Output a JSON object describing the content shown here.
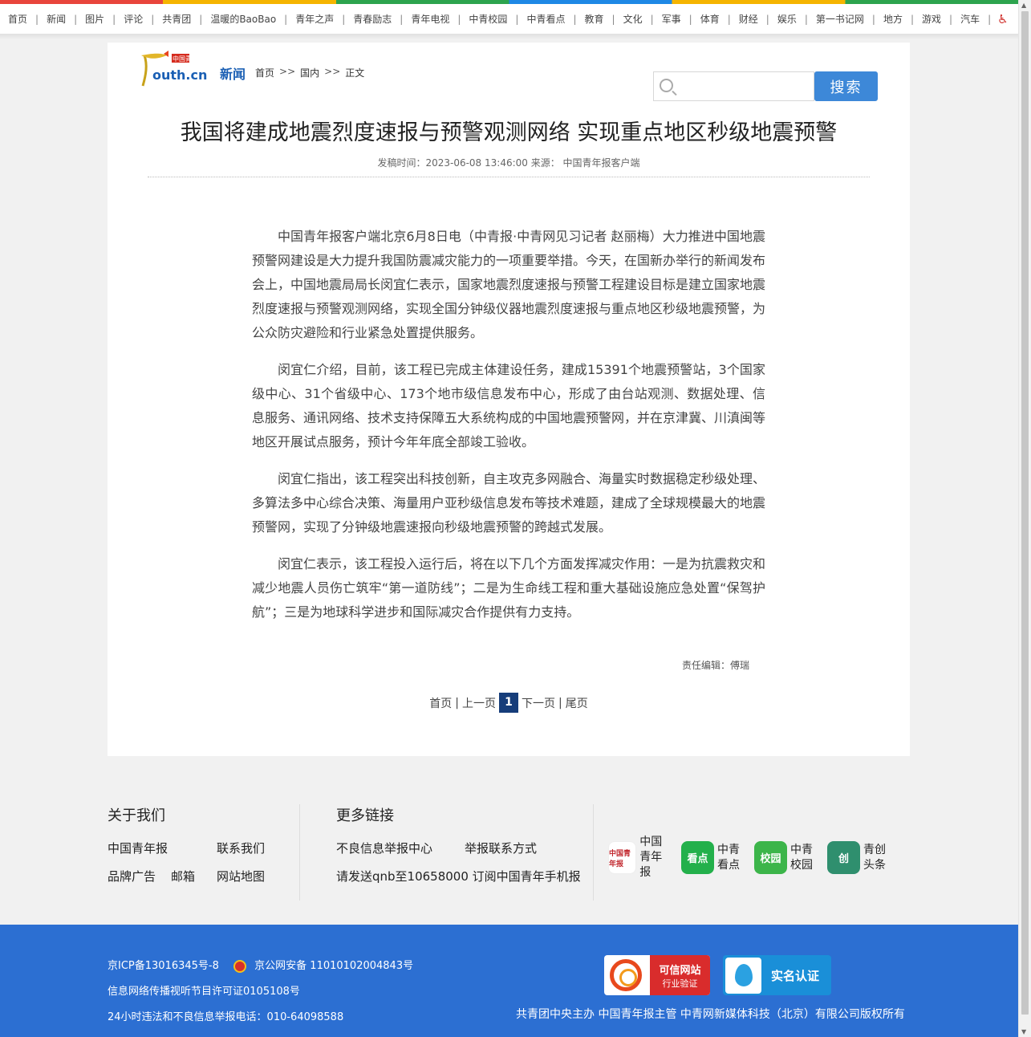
{
  "topnav": {
    "items": [
      "首页",
      "新闻",
      "图片",
      "评论",
      "共青团",
      "温暖的BaoBao",
      "青年之声",
      "青春励志",
      "青年电视",
      "中青校园",
      "中青看点",
      "教育",
      "文化",
      "军事",
      "体育",
      "财经",
      "娱乐",
      "第一书记网",
      "地方",
      "游戏",
      "汽车"
    ],
    "accessibility_icon": "wheelchair-icon"
  },
  "header": {
    "logo_text_top": "中国青年网",
    "logo_text_main": "outh.cn",
    "channel": "新闻",
    "breadcrumb": [
      "首页",
      "国内",
      "正文"
    ],
    "breadcrumb_sep": ">>",
    "search_placeholder": "",
    "search_button": "搜索"
  },
  "article": {
    "title": "我国将建成地震烈度速报与预警观测网络 实现重点地区秒级地震预警",
    "meta": "发稿时间：2023-06-08 13:46:00 来源： 中国青年报客户端",
    "paragraphs": [
      "中国青年报客户端北京6月8日电（中青报·中青网见习记者 赵丽梅）大力推进中国地震预警网建设是大力提升我国防震减灾能力的一项重要举措。今天，在国新办举行的新闻发布会上，中国地震局局长闵宜仁表示，国家地震烈度速报与预警工程建设目标是建立国家地震烈度速报与预警观测网络，实现全国分钟级仪器地震烈度速报与重点地区秒级地震预警，为公众防灾避险和行业紧急处置提供服务。",
      "闵宜仁介绍，目前，该工程已完成主体建设任务，建成15391个地震预警站，3个国家级中心、31个省级中心、173个地市级信息发布中心，形成了由台站观测、数据处理、信息服务、通讯网络、技术支持保障五大系统构成的中国地震预警网，并在京津冀、川滇闽等地区开展试点服务，预计今年年底全部竣工验收。",
      "闵宜仁指出，该工程突出科技创新，自主攻克多网融合、海量实时数据稳定秒级处理、多算法多中心综合决策、海量用户亚秒级信息发布等技术难题，建成了全球规模最大的地震预警网，实现了分钟级地震速报向秒级地震预警的跨越式发展。",
      "闵宜仁表示，该工程投入运行后，将在以下几个方面发挥减灾作用：一是为抗震救灾和减少地震人员伤亡筑牢“第一道防线”；二是为生命线工程和重大基础设施应急处置“保驾护航”；三是为地球科学进步和国际减灾合作提供有力支持。"
    ],
    "editor": "责任编辑：傅瑞"
  },
  "pager": {
    "first": "首页",
    "prev": "上一页",
    "current": "1",
    "next": "下一页",
    "last": "尾页",
    "sep": "|"
  },
  "footer": {
    "about_title": "关于我们",
    "about_links": [
      "中国青年报",
      "联系我们",
      "品牌广告",
      "邮箱",
      "网站地图"
    ],
    "more_title": "更多链接",
    "more_links": [
      "不良信息举报中心",
      "举报联系方式",
      "请发送qnb至10658000 订阅中国青年手机报"
    ],
    "apps": [
      {
        "icon_text": "中国青年报",
        "name1": "中国",
        "name2": "青年报",
        "color": "#ffffff"
      },
      {
        "icon_text": "看点",
        "name1": "中青",
        "name2": "看点",
        "color": "#23b04b"
      },
      {
        "icon_text": "校园",
        "name1": "中青",
        "name2": "校园",
        "color": "#3cb54a"
      },
      {
        "icon_text": "创",
        "name1": "青创",
        "name2": "头条",
        "color": "#2f8f6e"
      }
    ],
    "icp": "京ICP备13016345号-8",
    "police": "京公网安备 11010102004843号",
    "license": "信息网络传播视听节目许可证0105108号",
    "hotline": "24小时违法和不良信息举报电话：010-64098588",
    "cert1_a": "可信网站",
    "cert1_b": "行业验证",
    "cert2": "实名认证",
    "copyright": "共青团中央主办 中国青年报主管 中青网新媒体科技（北京）有限公司版权所有"
  },
  "colors": {
    "search_button": "#3d88d8",
    "footer_blue": "#2c6fd2",
    "pager_current": "#163d7a",
    "channel_blue": "#1a5fb4"
  }
}
